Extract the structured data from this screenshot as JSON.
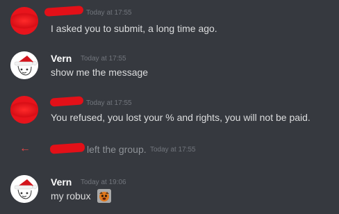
{
  "messages": [
    {
      "author": "",
      "timestamp": "Today at 17:55",
      "text": "I asked you to submit, a long time ago."
    },
    {
      "author": "Vern",
      "timestamp": "Today at 17:55",
      "text": "show me the message"
    },
    {
      "author": "",
      "timestamp": "Today at 17:55",
      "text": "You refused, you lost your % and rights, you will not be paid."
    },
    {
      "author": "Vern",
      "timestamp": "Today at 19:06",
      "text": "my robux"
    }
  ],
  "system_message": {
    "icon": "left-arrow-icon",
    "text": "left the group.",
    "timestamp": "Today at 17:55"
  },
  "colors": {
    "background": "#36393f",
    "username": "#ffffff",
    "message_text": "#dcddde",
    "timestamp": "#72767d",
    "leave_arrow": "#f04747",
    "redaction": "#e31018"
  }
}
